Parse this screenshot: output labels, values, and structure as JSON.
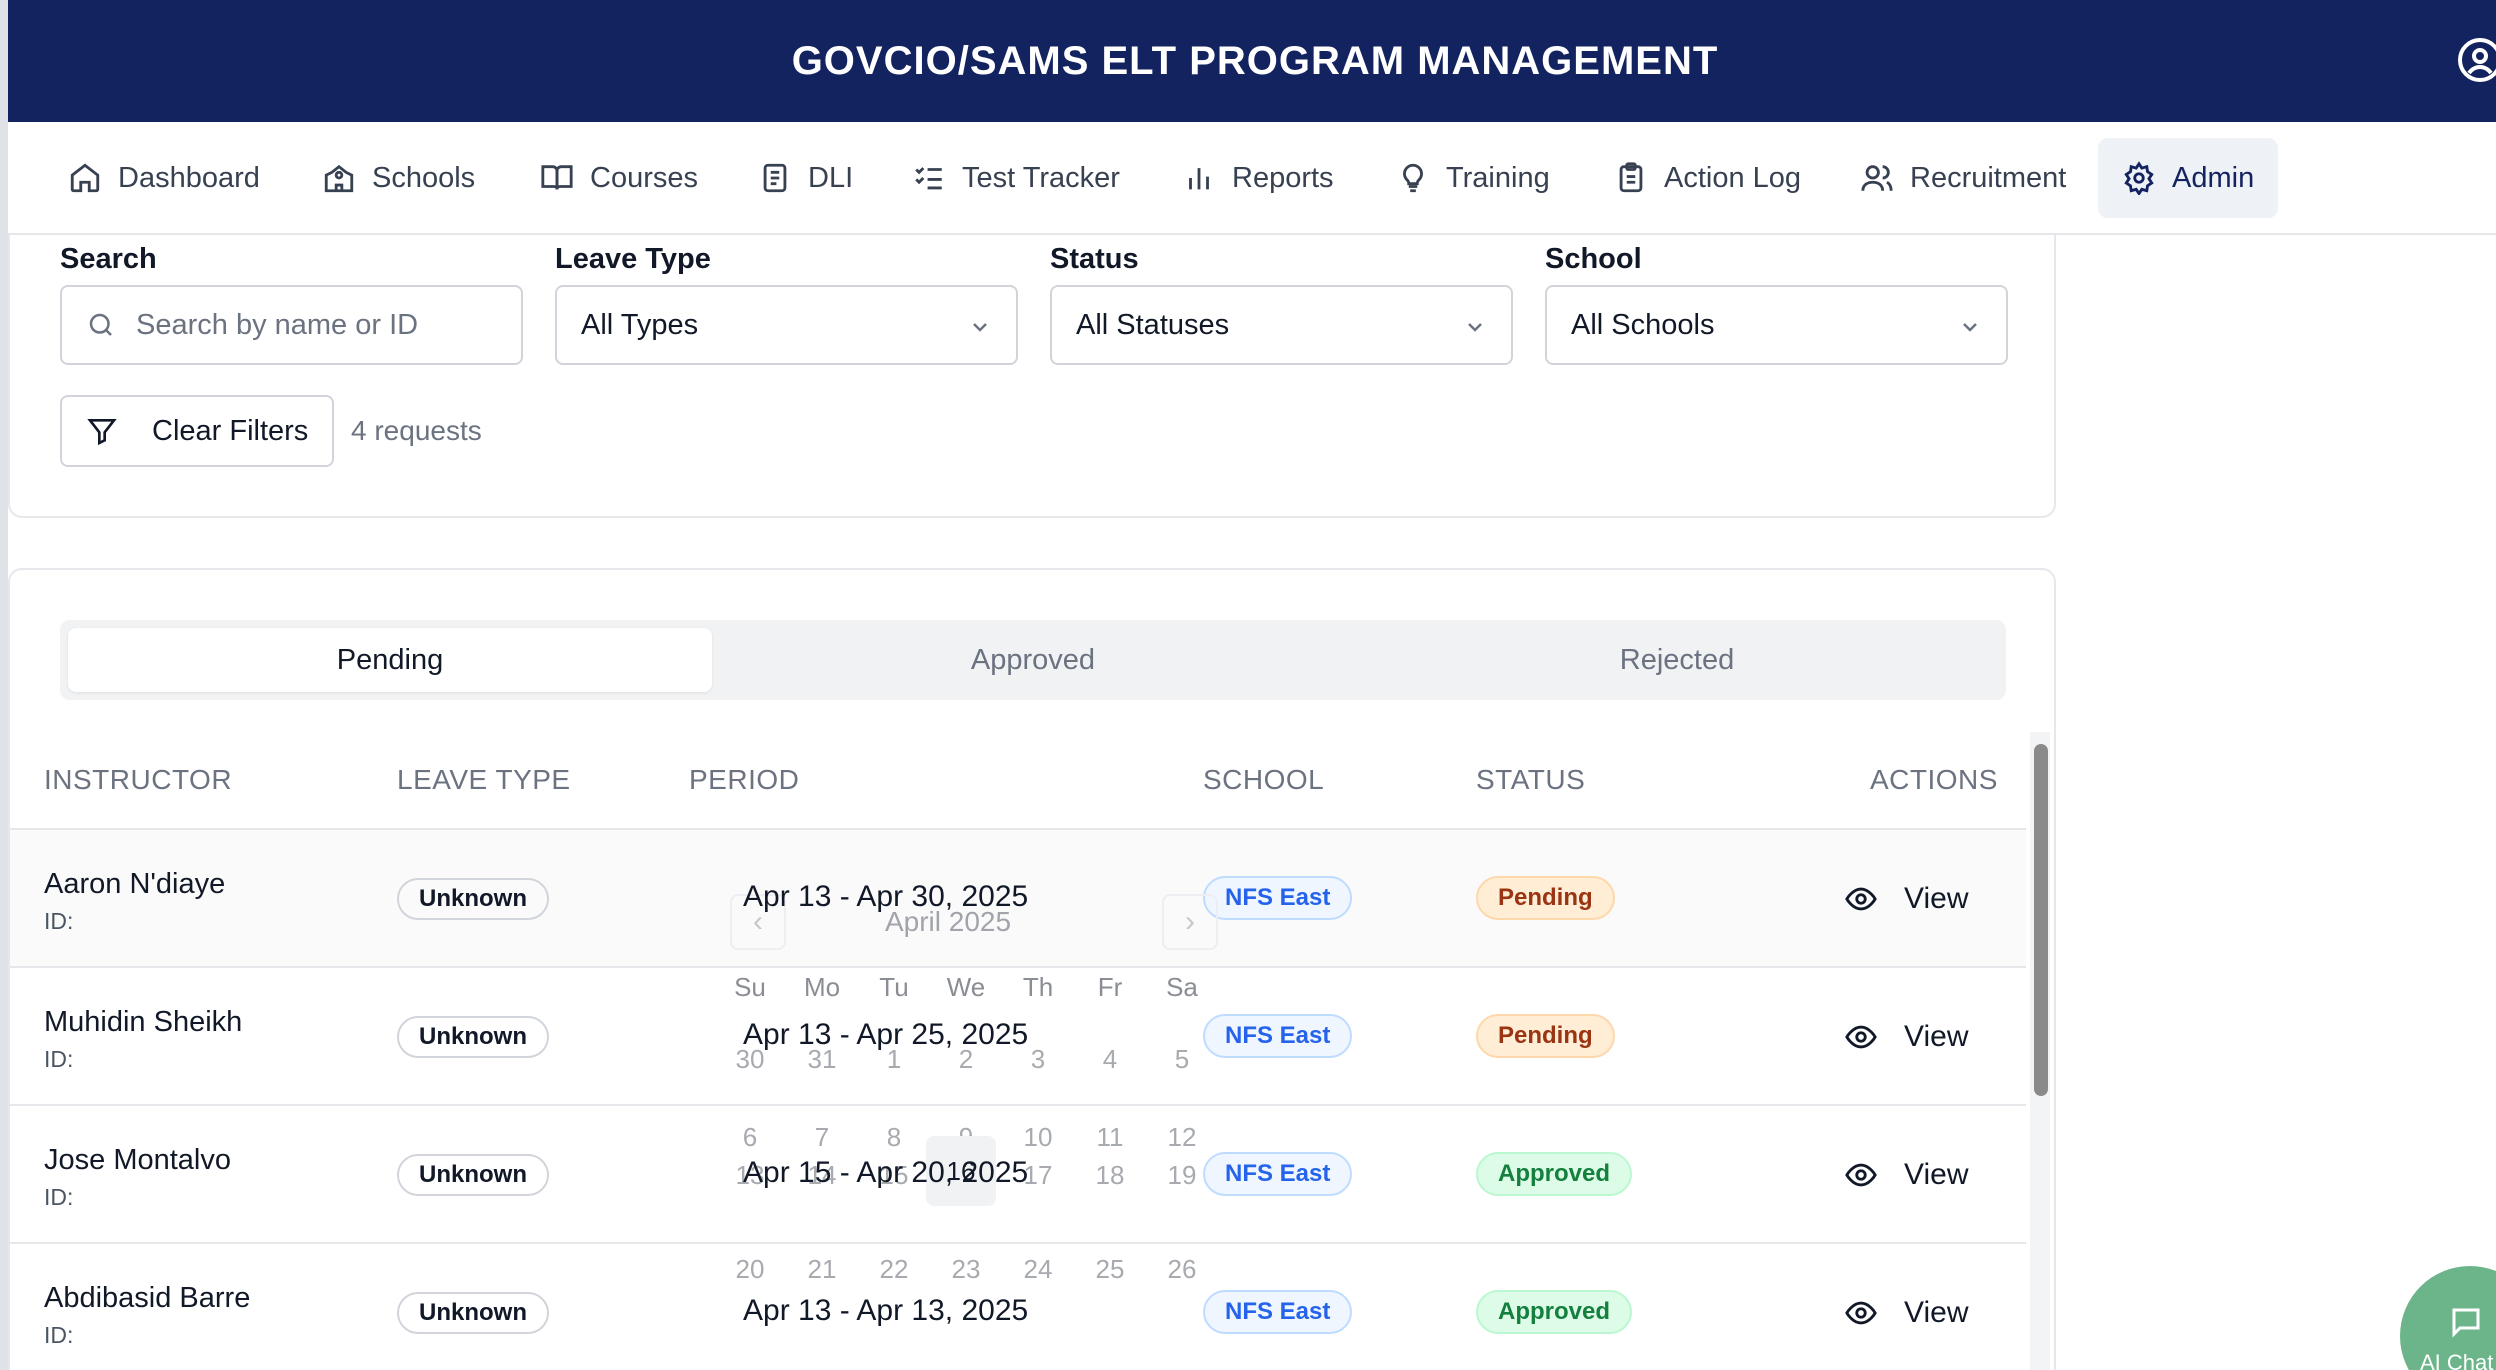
{
  "header": {
    "title": "GOVCIO/SAMS ELT PROGRAM MANAGEMENT"
  },
  "nav": {
    "items": [
      {
        "label": "Dashboard",
        "icon": "home-icon"
      },
      {
        "label": "Schools",
        "icon": "school-icon"
      },
      {
        "label": "Courses",
        "icon": "book-icon"
      },
      {
        "label": "DLI",
        "icon": "document-icon"
      },
      {
        "label": "Test Tracker",
        "icon": "list-check-icon"
      },
      {
        "label": "Reports",
        "icon": "bar-chart-icon"
      },
      {
        "label": "Training",
        "icon": "lightbulb-icon"
      },
      {
        "label": "Action Log",
        "icon": "clipboard-icon"
      },
      {
        "label": "Recruitment",
        "icon": "users-icon"
      },
      {
        "label": "Admin",
        "icon": "gear-icon",
        "active": true
      }
    ]
  },
  "filters": {
    "search": {
      "label": "Search",
      "placeholder": "Search by name or ID",
      "value": ""
    },
    "leave_type": {
      "label": "Leave Type",
      "value": "All Types"
    },
    "status": {
      "label": "Status",
      "value": "All Statuses"
    },
    "school": {
      "label": "School",
      "value": "All Schools"
    },
    "clear_label": "Clear Filters",
    "count_text": "4 requests"
  },
  "tabs": [
    {
      "label": "Pending",
      "active": true
    },
    {
      "label": "Approved"
    },
    {
      "label": "Rejected"
    }
  ],
  "table": {
    "headers": [
      "INSTRUCTOR",
      "LEAVE TYPE",
      "PERIOD",
      "SCHOOL",
      "STATUS",
      "ACTIONS"
    ],
    "rows": [
      {
        "name": "Aaron N'diaye",
        "id": "ID:",
        "leave_type": "Unknown",
        "period": "Apr 13 - Apr 30, 2025",
        "school": "NFS East",
        "status": "Pending",
        "action": "View"
      },
      {
        "name": "Muhidin Sheikh",
        "id": "ID:",
        "leave_type": "Unknown",
        "period": "Apr 13 - Apr 25, 2025",
        "school": "NFS East",
        "status": "Pending",
        "action": "View"
      },
      {
        "name": "Jose Montalvo",
        "id": "ID:",
        "leave_type": "Unknown",
        "period": "Apr 15 - Apr 20, 2025",
        "school": "NFS East",
        "status": "Approved",
        "action": "View"
      },
      {
        "name": "Abdibasid Barre",
        "id": "ID:",
        "leave_type": "Unknown",
        "period": "Apr 13 - Apr 13, 2025",
        "school": "NFS East",
        "status": "Approved",
        "action": "View"
      }
    ]
  },
  "calendar": {
    "month": "April 2025",
    "weekdays": [
      "Su",
      "Mo",
      "Tu",
      "We",
      "Th",
      "Fr",
      "Sa"
    ],
    "week1": [
      "30",
      "31",
      "1",
      "2",
      "3",
      "4",
      "5"
    ],
    "week2": [
      "6",
      "7",
      "8",
      "9",
      "10",
      "11",
      "12"
    ],
    "week3": [
      "13",
      "14",
      "15",
      "16",
      "17",
      "18",
      "19"
    ],
    "week4": [
      "20",
      "21",
      "22",
      "23",
      "24",
      "25",
      "26"
    ],
    "prev": "‹",
    "next": "›"
  },
  "ai_chat": {
    "label": "AI Chat"
  },
  "colors": {
    "header_bg": "#13235f",
    "pending_bg": "#ffedd5",
    "approved_bg": "#dcfce7",
    "school_badge": "#2563eb",
    "ai_chat": "#6cb58a"
  }
}
